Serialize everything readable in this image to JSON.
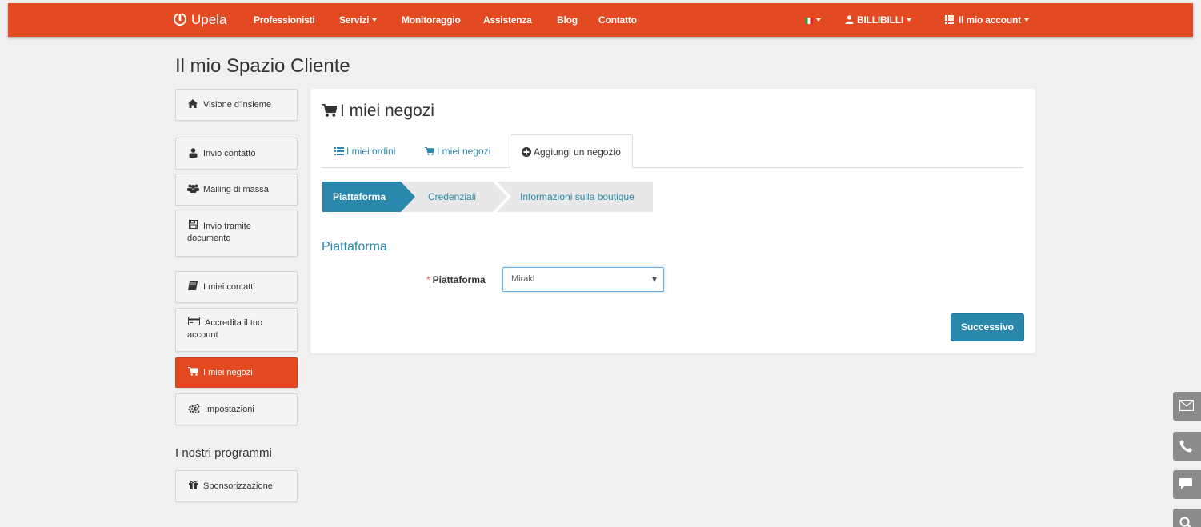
{
  "nav": {
    "brand": "Upela",
    "items": [
      "Professionisti",
      "Servizi",
      "Monitoraggio",
      "Assistenza",
      "Blog",
      "Contatto"
    ],
    "user": "BILLIBILLI",
    "account": "Il mio account"
  },
  "page_title": "Il mio Spazio Cliente",
  "sidebar": {
    "items": [
      {
        "label": "Visione d'insieme",
        "icon": "home-icon"
      },
      {
        "label": "Invio contatto",
        "icon": "user-icon"
      },
      {
        "label": "Mailing di massa",
        "icon": "users-icon"
      },
      {
        "label": "Invio tramite documento",
        "icon": "save-icon"
      },
      {
        "label": "I miei contatti",
        "icon": "book-icon"
      },
      {
        "label": "Accredita il tuo account",
        "icon": "credit-card-icon"
      },
      {
        "label": "I miei negozi",
        "icon": "cart-icon",
        "active": true
      },
      {
        "label": "Impostazioni",
        "icon": "cogs-icon"
      }
    ],
    "programs_title": "I nostri programmi",
    "sponsor": {
      "label": "Sponsorizzazione",
      "icon": "gift-icon"
    }
  },
  "panel": {
    "title": "I miei negozi",
    "tabs": [
      {
        "label": "I miei ordini",
        "icon": "list-icon"
      },
      {
        "label": "I miei negozi",
        "icon": "cart-icon"
      },
      {
        "label": "Aggiungi un negozio",
        "icon": "plus-circle-icon",
        "active": true
      }
    ],
    "steps": [
      {
        "label": "Piattaforma",
        "active": true
      },
      {
        "label": "Credenziali"
      },
      {
        "label": "Informazioni sulla boutique"
      }
    ],
    "section_title": "Piattaforma",
    "field": {
      "required_mark": "*",
      "label": "Piattaforma",
      "value": "Mirakl"
    },
    "next_button": "Successivo"
  },
  "colors": {
    "accent": "#e34a22",
    "primary": "#2a88ad"
  }
}
